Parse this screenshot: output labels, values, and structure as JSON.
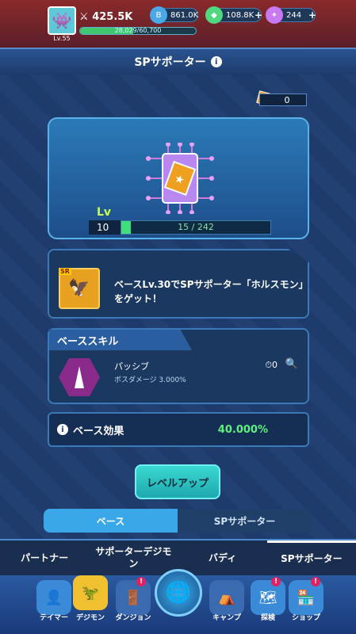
{
  "player": {
    "level": "Lv.55",
    "power": "425.5K",
    "exp_text": "28,029/60,700",
    "exp_fraction": 0.46
  },
  "currencies": [
    {
      "name": "bits",
      "value": "861.0K",
      "color": "#4aa8e8"
    },
    {
      "name": "gems",
      "value": "108.8K",
      "color": "#50d880"
    },
    {
      "name": "stones",
      "value": "244",
      "color": "#c878f0"
    }
  ],
  "panel": {
    "title": "SPサポーター"
  },
  "card_count": "0",
  "chip": {
    "lv_label": "Lv",
    "level": "10",
    "progress_text": "15 / 242",
    "progress_fraction": 0.062
  },
  "mission": {
    "tag": "SR",
    "text": "ベースLv.30でSPサポーター「ホルスモン」をゲット！"
  },
  "skill": {
    "header": "ベーススキル",
    "name": "パッシブ",
    "desc": "ボスダメージ 3.000%",
    "timer": "0"
  },
  "effect": {
    "label": "ベース効果",
    "value": "40.000%"
  },
  "level_up_label": "レベルアップ",
  "subtabs": [
    {
      "label": "ベース",
      "active": true
    },
    {
      "label": "SPサポーター",
      "active": false
    }
  ],
  "bottom_tabs": [
    {
      "label": "パートナー",
      "active": false
    },
    {
      "label": "サポーターデジモン",
      "active": false
    },
    {
      "label": "バディ",
      "active": false
    },
    {
      "label": "SPサポーター",
      "active": true
    }
  ],
  "nav": [
    {
      "label": "テイマー",
      "icon": "tamer-icon"
    },
    {
      "label": "デジモン",
      "icon": "digimon-icon"
    },
    {
      "label": "ダンジョン",
      "icon": "dungeon-icon"
    },
    {
      "label": "キャンプ",
      "icon": "camp-icon"
    },
    {
      "label": "探検",
      "icon": "explore-icon"
    },
    {
      "label": "ショップ",
      "icon": "shop-icon"
    }
  ]
}
